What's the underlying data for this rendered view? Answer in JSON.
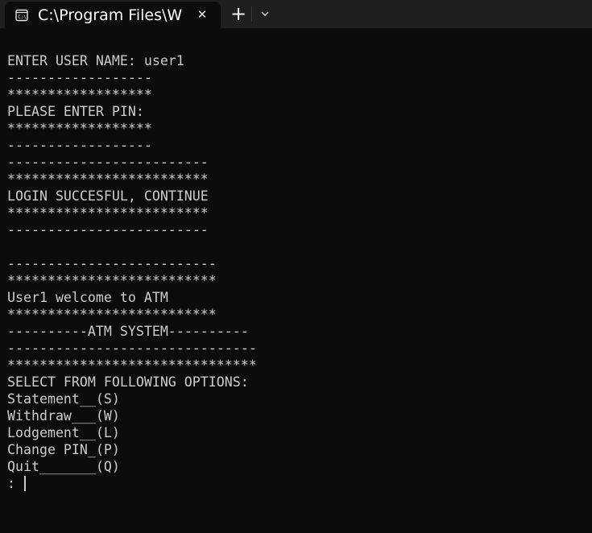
{
  "tab": {
    "title": "C:\\Program Files\\W",
    "close_glyph": "✕",
    "new_tab_glyph": "+",
    "dropdown_icon": "chevron-down-icon",
    "icon": "terminal-icon"
  },
  "terminal": {
    "lines": [
      "ENTER USER NAME: user1",
      "------------------",
      "******************",
      "PLEASE ENTER PIN:",
      "******************",
      "------------------",
      "-------------------------",
      "*************************",
      "LOGIN SUCCESFUL, CONTINUE",
      "*************************",
      "-------------------------",
      "",
      "--------------------------",
      "**************************",
      "User1 welcome to ATM",
      "**************************",
      "----------ATM SYSTEM----------",
      "-------------------------------",
      "*******************************",
      "SELECT FROM FOLLOWING OPTIONS:",
      "Statement__(S)",
      "Withdraw___(W)",
      "Lodgement__(L)",
      "Change PIN_(P)",
      "Quit_______(Q)"
    ],
    "prompt": ": "
  },
  "colors": {
    "background": "#0c0c0c",
    "tabbar": "#1f1f1f",
    "text": "#cccccc"
  }
}
